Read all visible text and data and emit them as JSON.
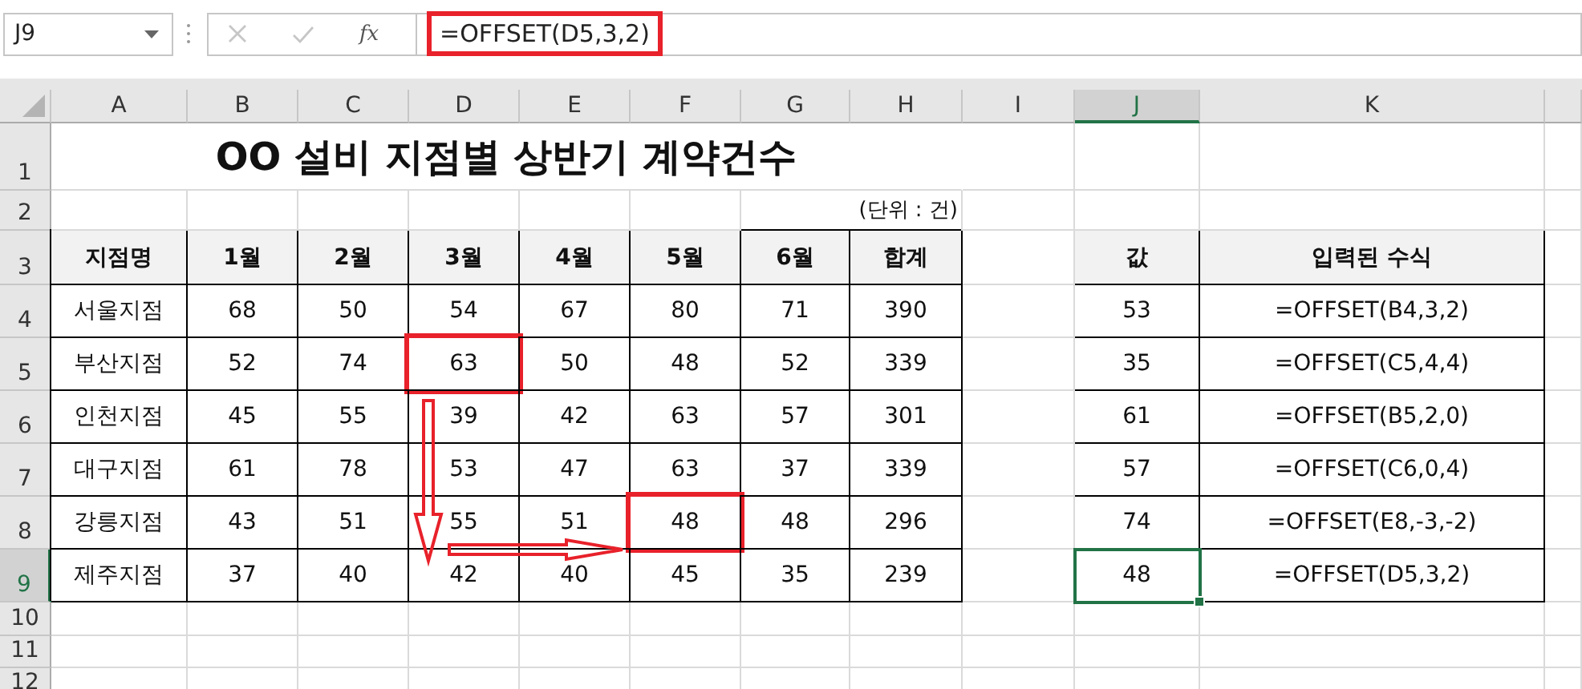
{
  "name_box": {
    "value": "J9"
  },
  "formula_bar": {
    "function_label": "fx",
    "value": "=OFFSET(D5,3,2)",
    "highlighted": true
  },
  "column_headers": [
    {
      "label": "A",
      "selected": false
    },
    {
      "label": "B",
      "selected": false
    },
    {
      "label": "C",
      "selected": false
    },
    {
      "label": "D",
      "selected": false
    },
    {
      "label": "E",
      "selected": false
    },
    {
      "label": "F",
      "selected": false
    },
    {
      "label": "G",
      "selected": false
    },
    {
      "label": "H",
      "selected": false
    },
    {
      "label": "I",
      "selected": false
    },
    {
      "label": "J",
      "selected": true
    },
    {
      "label": "K",
      "selected": false
    }
  ],
  "row_headers": [
    {
      "label": "1",
      "selected": false
    },
    {
      "label": "2",
      "selected": false
    },
    {
      "label": "3",
      "selected": false
    },
    {
      "label": "4",
      "selected": false
    },
    {
      "label": "5",
      "selected": false
    },
    {
      "label": "6",
      "selected": false
    },
    {
      "label": "7",
      "selected": false
    },
    {
      "label": "8",
      "selected": false
    },
    {
      "label": "9",
      "selected": true
    },
    {
      "label": "10",
      "selected": false
    },
    {
      "label": "11",
      "selected": false
    },
    {
      "label": "12",
      "selected": false
    }
  ],
  "title": "OO 설비 지점별 상반기 계약건수",
  "unit_note": "(단위 : 건)",
  "contract_table": {
    "columns": [
      "지점명",
      "1월",
      "2월",
      "3월",
      "4월",
      "5월",
      "6월",
      "합계"
    ],
    "rows": [
      {
        "branch": "서울지점",
        "months": [
          {
            "text": "68",
            "highlighted": false
          },
          {
            "text": "50",
            "highlighted": false
          },
          {
            "text": "54",
            "highlighted": false
          },
          {
            "text": "67",
            "highlighted": false
          },
          {
            "text": "80",
            "highlighted": false
          },
          {
            "text": "71",
            "highlighted": false
          }
        ],
        "total": "390"
      },
      {
        "branch": "부산지점",
        "months": [
          {
            "text": "52",
            "highlighted": false
          },
          {
            "text": "74",
            "highlighted": false
          },
          {
            "text": "63",
            "highlighted": true
          },
          {
            "text": "50",
            "highlighted": false
          },
          {
            "text": "48",
            "highlighted": false
          },
          {
            "text": "52",
            "highlighted": false
          }
        ],
        "total": "339"
      },
      {
        "branch": "인천지점",
        "months": [
          {
            "text": "45",
            "highlighted": false
          },
          {
            "text": "55",
            "highlighted": false
          },
          {
            "text": "39",
            "highlighted": false
          },
          {
            "text": "42",
            "highlighted": false
          },
          {
            "text": "63",
            "highlighted": false
          },
          {
            "text": "57",
            "highlighted": false
          }
        ],
        "total": "301"
      },
      {
        "branch": "대구지점",
        "months": [
          {
            "text": "61",
            "highlighted": false
          },
          {
            "text": "78",
            "highlighted": false
          },
          {
            "text": "53",
            "highlighted": false
          },
          {
            "text": "47",
            "highlighted": false
          },
          {
            "text": "63",
            "highlighted": false
          },
          {
            "text": "37",
            "highlighted": false
          }
        ],
        "total": "339"
      },
      {
        "branch": "강릉지점",
        "months": [
          {
            "text": "43",
            "highlighted": false
          },
          {
            "text": "51",
            "highlighted": false
          },
          {
            "text": "55",
            "highlighted": false
          },
          {
            "text": "51",
            "highlighted": false
          },
          {
            "text": "48",
            "highlighted": true
          },
          {
            "text": "48",
            "highlighted": false
          }
        ],
        "total": "296"
      },
      {
        "branch": "제주지점",
        "months": [
          {
            "text": "37",
            "highlighted": false
          },
          {
            "text": "40",
            "highlighted": false
          },
          {
            "text": "42",
            "highlighted": false
          },
          {
            "text": "40",
            "highlighted": false
          },
          {
            "text": "45",
            "highlighted": false
          },
          {
            "text": "35",
            "highlighted": false
          }
        ],
        "total": "239"
      }
    ]
  },
  "formula_table": {
    "columns": [
      "값",
      "입력된 수식"
    ],
    "rows": [
      {
        "value": "53",
        "formula": "=OFFSET(B4,3,2)",
        "selected": false
      },
      {
        "value": "35",
        "formula": "=OFFSET(C5,4,4)",
        "selected": false
      },
      {
        "value": "61",
        "formula": "=OFFSET(B5,2,0)",
        "selected": false
      },
      {
        "value": "57",
        "formula": "=OFFSET(C6,0,4)",
        "selected": false
      },
      {
        "value": "74",
        "formula": "=OFFSET(E8,-3,-2)",
        "selected": false
      },
      {
        "value": "48",
        "formula": "=OFFSET(D5,3,2)",
        "selected": true
      }
    ]
  }
}
